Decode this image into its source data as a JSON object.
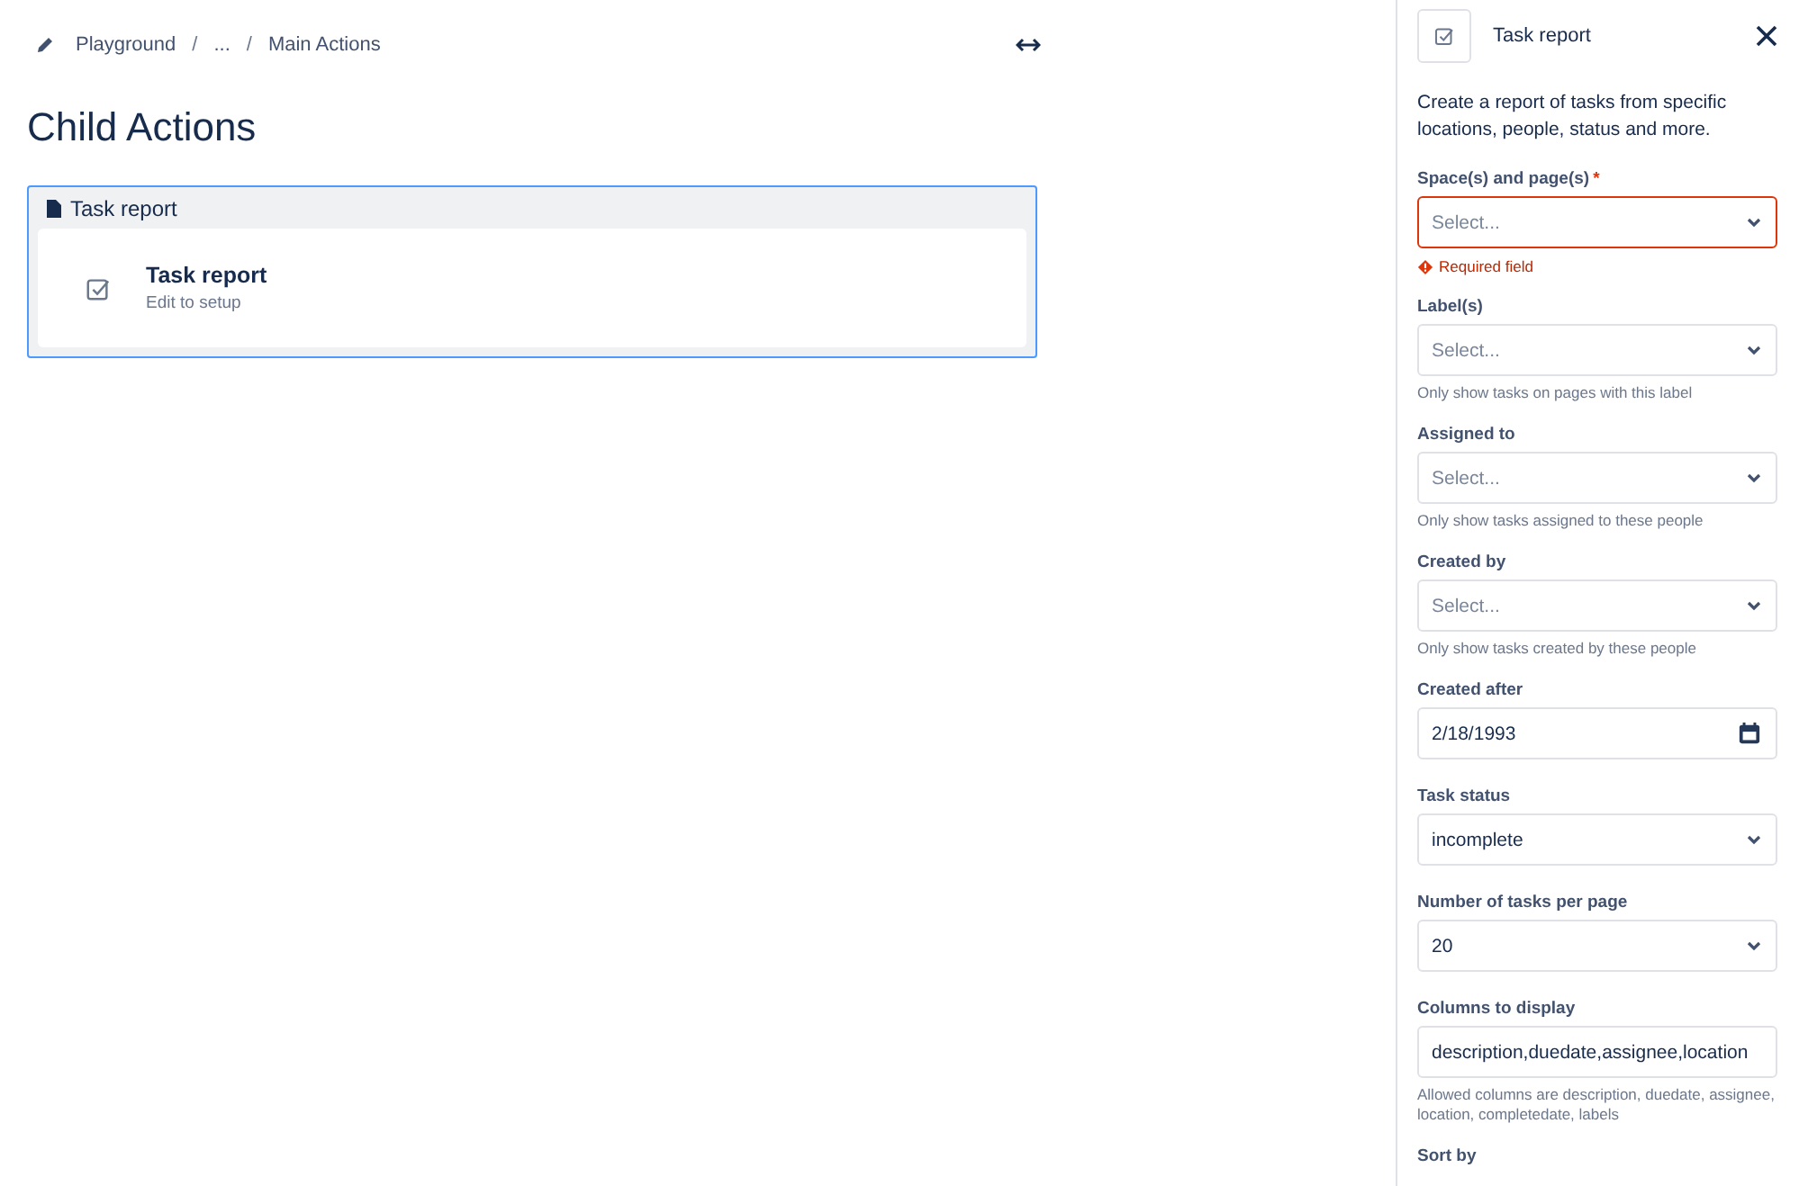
{
  "breadcrumb": [
    {
      "kind": "link",
      "text": "Playground"
    },
    {
      "kind": "separator",
      "text": "/"
    },
    {
      "kind": "link",
      "text": "..."
    },
    {
      "kind": "separator",
      "text": "/"
    },
    {
      "kind": "link",
      "text": "Main Actions"
    }
  ],
  "page_title": "Child Actions",
  "macro_card": {
    "header": "Task report",
    "title": "Task report",
    "subtitle": "Edit to setup"
  },
  "panel": {
    "title": "Task report",
    "description": "Create a report of tasks from specific locations, people, status and more.",
    "fields": [
      {
        "kind": "select",
        "label": "Space(s) and page(s)",
        "required_mark": "*",
        "placeholder": "Select...",
        "error": "Required field"
      },
      {
        "kind": "select",
        "label": "Label(s)",
        "placeholder": "Select...",
        "help": "Only show tasks on pages with this label"
      },
      {
        "kind": "select",
        "label": "Assigned to",
        "placeholder": "Select...",
        "help": "Only show tasks assigned to these people"
      },
      {
        "kind": "select",
        "label": "Created by",
        "placeholder": "Select...",
        "help": "Only show tasks created by these people"
      },
      {
        "kind": "date",
        "label": "Created after",
        "value": "2/18/1993"
      },
      {
        "kind": "select",
        "label": "Task status",
        "value": "incomplete"
      },
      {
        "kind": "select",
        "label": "Number of tasks per page",
        "value": "20"
      },
      {
        "kind": "text",
        "label": "Columns to display",
        "value": "description,duedate,assignee,location",
        "help": "Allowed columns are description, duedate, assignee, location, completedate, labels"
      },
      {
        "kind": "label",
        "label": "Sort by"
      }
    ]
  }
}
